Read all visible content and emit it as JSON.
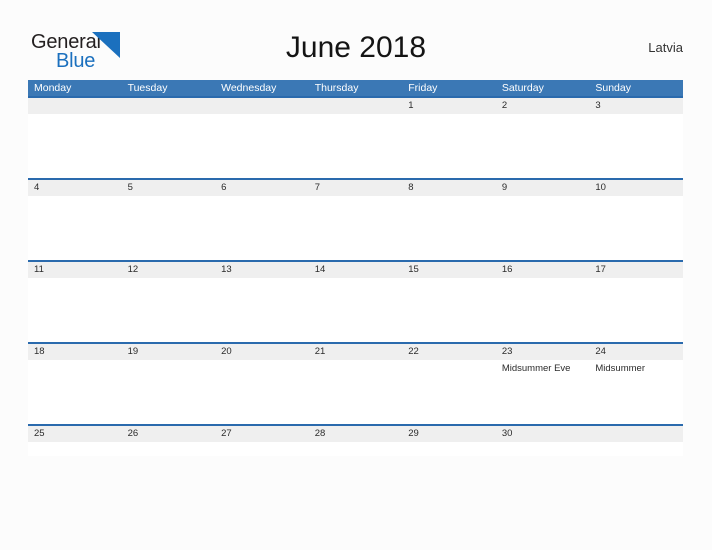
{
  "brand": {
    "name_part1": "General",
    "name_part2": "Blue",
    "triangle_color": "#1b70be",
    "text_color": "#231f20",
    "blue_color": "#1b70be"
  },
  "header": {
    "title": "June 2018",
    "country": "Latvia"
  },
  "colors": {
    "header_blue": "#3b78b5",
    "row_divider_blue": "#2a6aad",
    "band_gray": "#efefef",
    "page_background": "#fcfcfc"
  },
  "calendar": {
    "weekdays": [
      "Monday",
      "Tuesday",
      "Wednesday",
      "Thursday",
      "Friday",
      "Saturday",
      "Sunday"
    ],
    "weeks": [
      [
        {
          "day": "",
          "event": ""
        },
        {
          "day": "",
          "event": ""
        },
        {
          "day": "",
          "event": ""
        },
        {
          "day": "",
          "event": ""
        },
        {
          "day": "1",
          "event": ""
        },
        {
          "day": "2",
          "event": ""
        },
        {
          "day": "3",
          "event": ""
        }
      ],
      [
        {
          "day": "4",
          "event": ""
        },
        {
          "day": "5",
          "event": ""
        },
        {
          "day": "6",
          "event": ""
        },
        {
          "day": "7",
          "event": ""
        },
        {
          "day": "8",
          "event": ""
        },
        {
          "day": "9",
          "event": ""
        },
        {
          "day": "10",
          "event": ""
        }
      ],
      [
        {
          "day": "11",
          "event": ""
        },
        {
          "day": "12",
          "event": ""
        },
        {
          "day": "13",
          "event": ""
        },
        {
          "day": "14",
          "event": ""
        },
        {
          "day": "15",
          "event": ""
        },
        {
          "day": "16",
          "event": ""
        },
        {
          "day": "17",
          "event": ""
        }
      ],
      [
        {
          "day": "18",
          "event": ""
        },
        {
          "day": "19",
          "event": ""
        },
        {
          "day": "20",
          "event": ""
        },
        {
          "day": "21",
          "event": ""
        },
        {
          "day": "22",
          "event": ""
        },
        {
          "day": "23",
          "event": "Midsummer Eve"
        },
        {
          "day": "24",
          "event": "Midsummer"
        }
      ],
      [
        {
          "day": "25",
          "event": ""
        },
        {
          "day": "26",
          "event": ""
        },
        {
          "day": "27",
          "event": ""
        },
        {
          "day": "28",
          "event": ""
        },
        {
          "day": "29",
          "event": ""
        },
        {
          "day": "30",
          "event": ""
        },
        {
          "day": "",
          "event": ""
        }
      ]
    ]
  }
}
